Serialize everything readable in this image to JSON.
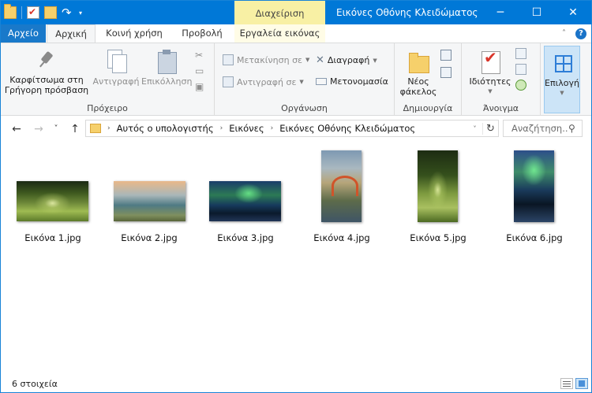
{
  "window": {
    "title": "Εικόνες Οθόνης Κλειδώματος",
    "context_tab": "Διαχείριση",
    "caption": {
      "minimize": "─",
      "maximize": "☐",
      "close": "✕"
    },
    "accent": "#0078d7"
  },
  "qat": {
    "undo": "↷",
    "dropdown": "▾"
  },
  "ribbon_tabs": {
    "file": "Αρχείο",
    "home": "Αρχική",
    "share": "Κοινή χρήση",
    "view": "Προβολή",
    "picture_tools": "Εργαλεία εικόνας",
    "collapse": "˄",
    "help": "?"
  },
  "ribbon": {
    "clipboard": {
      "label": "Πρόχειρο",
      "pin_line1": "Καρφίτσωμα στη",
      "pin_line2": "Γρήγορη πρόσβαση",
      "copy": "Αντιγραφή",
      "paste": "Επικόλληση"
    },
    "organize": {
      "label": "Οργάνωση",
      "move_to": "Μετακίνηση σε",
      "copy_to": "Αντιγραφή σε",
      "delete": "Διαγραφή",
      "rename": "Μετονομασία"
    },
    "new": {
      "label": "Δημιουργία",
      "new_folder_line1": "Νέος",
      "new_folder_line2": "φάκελος"
    },
    "open": {
      "label": "Άνοιγμα",
      "properties": "Ιδιότητες"
    },
    "select": {
      "select": "Επιλογή"
    }
  },
  "nav": {
    "back": "←",
    "forward": "→",
    "recent": "˅",
    "up": "↑",
    "breadcrumb": [
      "Αυτός ο υπολογιστής",
      "Εικόνες",
      "Εικόνες Οθόνης Κλειδώματος"
    ],
    "crumb_sep": "›",
    "address_dropdown": "˅",
    "refresh": "↻",
    "search_placeholder": "Αναζήτηση...",
    "search_icon": "⚲"
  },
  "files": [
    {
      "name": "Εικόνα 1.jpg",
      "orientation": "landscape",
      "thumbnail": "forest-road-landscape"
    },
    {
      "name": "Εικόνα 2.jpg",
      "orientation": "landscape",
      "thumbnail": "lake-bridge-landscape"
    },
    {
      "name": "Εικόνα 3.jpg",
      "orientation": "landscape",
      "thumbnail": "aurora-landscape"
    },
    {
      "name": "Εικόνα 4.jpg",
      "orientation": "portrait",
      "thumbnail": "bridge-portrait"
    },
    {
      "name": "Εικόνα 5.jpg",
      "orientation": "portrait",
      "thumbnail": "forest-road-portrait"
    },
    {
      "name": "Εικόνα 6.jpg",
      "orientation": "portrait",
      "thumbnail": "aurora-portrait"
    }
  ],
  "status": {
    "item_count": "6 στοιχεία"
  }
}
